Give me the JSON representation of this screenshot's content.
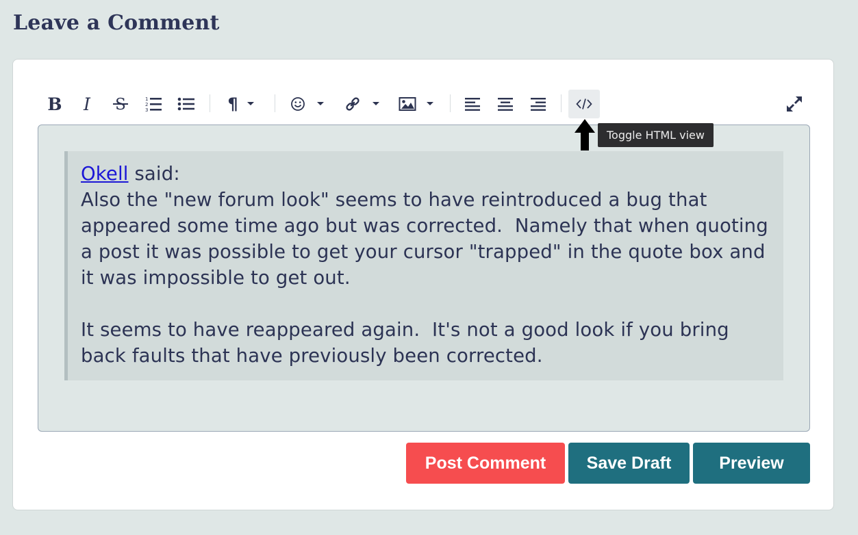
{
  "page": {
    "heading": "Leave a Comment"
  },
  "toolbar": {
    "bold_label": "B",
    "italic_label": "I",
    "paragraph_label": "¶",
    "tooltip": "Toggle HTML view"
  },
  "quote": {
    "author": "Okell",
    "said": " said:",
    "body": "Also the \"new forum look\" seems to have reintroduced a bug that appeared some time ago but was corrected.  Namely that when quoting a post it was possible to get your cursor \"trapped\" in the quote box and it was impossible to get out.\n\nIt seems to have reappeared again.  It's not a good look if you bring back faults that have previously been corrected."
  },
  "actions": {
    "post_label": "Post Comment",
    "draft_label": "Save Draft",
    "preview_label": "Preview"
  },
  "colors": {
    "page_bg": "#dfe7e6",
    "post_button": "#f64d4f",
    "secondary_button": "#1f6f7f",
    "link": "#1b16d6",
    "text": "#2c3354"
  }
}
